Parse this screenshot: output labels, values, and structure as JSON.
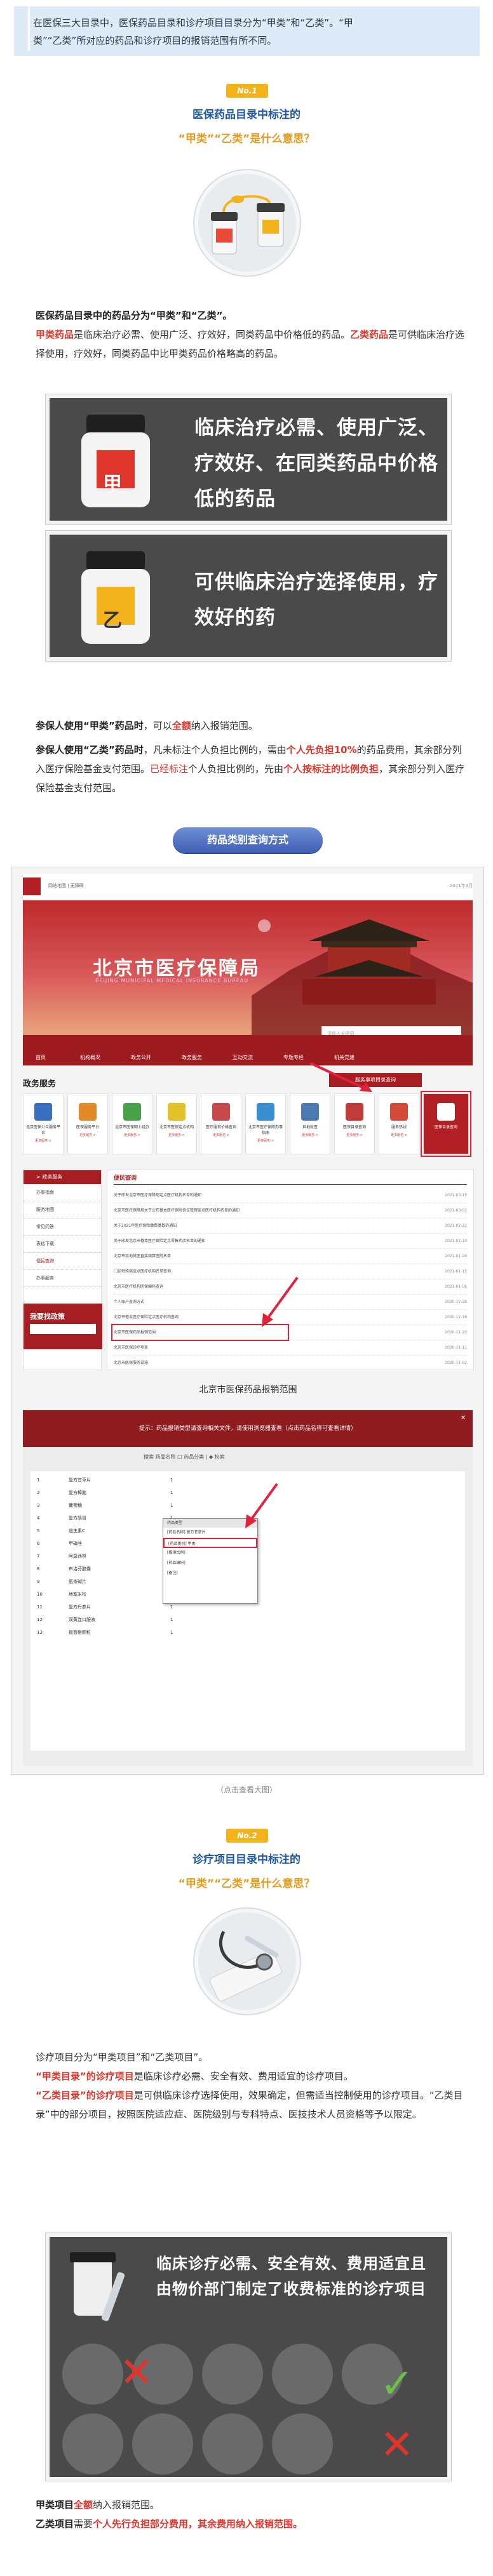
{
  "intro": {
    "line1": "在医保三大目录中，医保药品目录和诊疗项目目录分为“甲类”和“乙类”。“甲",
    "line2": "类”“乙类”所对应的药品和诊疗项目的报销范围有所不同。"
  },
  "section1": {
    "badge": "No.1",
    "title_blue": "医保药品目录",
    "title_rest": "中标注的",
    "subtitle": "“甲类”“乙类”是什么意思？",
    "para1_bold": "医保药品目录中的药品分为“甲类”和“乙类”。",
    "para2_red1": "甲类药品",
    "para2_text1": "是临床治疗必需、使用广泛、疗效好，同类药品中价格低的药品。",
    "para2_red2": "乙类药品",
    "para2_text2": "是可供临床治疗选择使用，疗效好，同类药品中比甲类药品价格略高的药品。",
    "card1_text": "临床治疗必需、使用广泛、疗效好、在同类药品中价格低的药品",
    "card1_label": "甲",
    "card2_text": "可供临床治疗选择使用，疗效好的药",
    "card2_label": "乙",
    "use1_bold": "参保人使用“甲类”药品时",
    "use1_text1": "，可以",
    "use1_red": "全额",
    "use1_text2": "纳入报销范围。",
    "use2_bold": "参保人使用“乙类”药品时",
    "use2_text1": "，凡未标注个人负担比例的，需由",
    "use2_red1": "个人先负担10%",
    "use2_text2": "的药品费用，其余部分列入医疗保险基金支付范围。",
    "use2_redplain": "已经标注",
    "use2_text3": "个人负担比例的，先由",
    "use2_red2": "个人按标注的比例负担",
    "use2_text4": "，其余部分列入医疗保险基金支付范围。",
    "button": "药品类别查询方式"
  },
  "screenshot": {
    "banner_title": "北京市医疗保障局",
    "banner_sub": "BEIJING MUNICIPAL MEDICAL INSURANCE BUREAU",
    "head_links": "网站地图  |  无障碍",
    "head_right": "2021年3月",
    "nav_items": [
      "首页",
      "机构概况",
      "政务公开",
      "政务服务",
      "互动交流",
      "专题专栏",
      "机关党建"
    ],
    "search_placeholder": "请输入关键词",
    "gov_heading": "政务服务",
    "gov_button": "服务事项目录查询",
    "tiles": [
      {
        "label": "北京医保公众服务平台",
        "color": "#3a6fc0"
      },
      {
        "label": "医保服务平台",
        "color": "#e08a2a"
      },
      {
        "label": "北京市医保网上经办",
        "color": "#49a24a"
      },
      {
        "label": "北京市医保定点机构",
        "color": "#e2c12a"
      },
      {
        "label": "医疗服务价格查询",
        "color": "#c94a4a"
      },
      {
        "label": "北京市医疗保障办事指南",
        "color": "#3a8fd0"
      },
      {
        "label": "异地就医",
        "color": "#4d7ab0"
      },
      {
        "label": "医保目录查询",
        "color": "#c23b3b"
      },
      {
        "label": "服务热线",
        "color": "#d34a3a"
      },
      {
        "label": "医保目录查询",
        "color": "#b21f24"
      }
    ],
    "tile_more": "更多服务 >",
    "left_menu_heading": "> 政务服务",
    "left_menu": [
      "办事指南",
      "服务地图",
      "常见问答",
      "表格下载",
      "便民查询",
      "办事服务"
    ],
    "help_title": "我要找政策",
    "news_heading": "便民查询",
    "news": [
      {
        "t": "关于印发北京市医疗保障局定点医疗机构名单的通知",
        "d": "2021-03-15"
      },
      {
        "t": "北京市医疗保障局关于公布基本医疗保险协议管理定点医疗机构名单的通知",
        "d": "2021-03-02"
      },
      {
        "t": "关于2021年医疗保险缴费基数的通知",
        "d": "2021-02-22"
      },
      {
        "t": "关于印发北京市基本医疗保险定点零售药店名单的通知",
        "d": "2021-02-10"
      },
      {
        "t": "北京市异地就医直接结算医院名单",
        "d": "2021-01-28"
      },
      {
        "t": "门诊特殊病定点医疗机构名单查询",
        "d": "2021-01-15"
      },
      {
        "t": "北京市医疗机构医保编码查询",
        "d": "2021-01-06"
      },
      {
        "t": "个人账户查询方式",
        "d": "2020-12-28"
      },
      {
        "t": "北京市基本医疗保险定点医疗机构查询",
        "d": "2020-12-18"
      },
      {
        "t": "企业医保登记、企业缴费情况查询",
        "d": "2020-12-09"
      },
      {
        "t": "医保卡挂失补办查询",
        "d": "2020-11-30"
      },
      {
        "t": "北京市医保药品报销范围",
        "d": "2020-11-20"
      },
      {
        "t": "北京市医保诊疗项目",
        "d": "2020-11-11"
      },
      {
        "t": "北京市医保服务设施",
        "d": "2020-11-02"
      },
      {
        "t": "门诊慢特病查询",
        "d": "2020-10-24"
      }
    ],
    "caption": "北京市医保药品报销范围",
    "sub_bar": "提示：药品报销类型请查询相关文件，请使用浏览器查看（点击药品名称可查看详情）",
    "sub_toolbar": "搜索 药品名称 □ 药品分类  |  ◆ 检索",
    "sub_rows": [
      {
        "n": "1",
        "name": "复方甘草片",
        "c": "1"
      },
      {
        "n": "2",
        "name": "复方樟脑",
        "c": "1"
      },
      {
        "n": "3",
        "name": "葡萄糖",
        "c": "1"
      },
      {
        "n": "4",
        "name": "复方感冒",
        "c": "1"
      },
      {
        "n": "5",
        "name": "维生素C",
        "c": "1"
      },
      {
        "n": "6",
        "name": "甲硝唑",
        "c": "1"
      },
      {
        "n": "7",
        "name": "阿莫西林",
        "c": "1"
      },
      {
        "n": "8",
        "name": "布洛芬胶囊",
        "c": "1"
      },
      {
        "n": "9",
        "name": "氨茶碱片",
        "c": "1"
      },
      {
        "n": "10",
        "name": "地塞米松",
        "c": "1"
      },
      {
        "n": "11",
        "name": "复方丹参片",
        "c": "1"
      },
      {
        "n": "12",
        "name": "双黄连口服液",
        "c": "1"
      },
      {
        "n": "13",
        "name": "板蓝根颗粒",
        "c": "1"
      }
    ],
    "popup_title": "药品类型",
    "popup_items": [
      "[药品名称]  复方甘草片",
      "[药品类别]  甲类",
      "[报销比例]",
      "[药品编码]",
      "[备注]"
    ]
  },
  "caption_below": "（点击查看大图）",
  "section2": {
    "badge": "No.2",
    "title_blue": "诊疗项目目录",
    "title_rest": "中标注的",
    "subtitle": "“甲类”“乙类”是什么意思？",
    "para1": "诊疗项目分为“甲类项目”和“乙类项目”。",
    "p2_red": "“甲类目录”的诊疗项目",
    "p2_text": "是临床诊疗必需、安全有效、费用适宜的诊疗项目。",
    "p3_red": "“乙类目录”的诊疗项目",
    "p3_text": "是可供临床诊疗选择使用，效果确定，但需适当控制使用的诊疗项目。“乙类目录”中的部分项目，按照医院适应症、医院级别与专科特点、医技技术人员资格等予以限定。",
    "card_text": "临床诊疗必需、安全有效、费用适宜且由物价部门制定了收费标准的诊疗项目",
    "tail1_bold": "甲类项目",
    "tail1_red": "全额",
    "tail1_text": "纳入报销范围。",
    "tail2_bold": "乙类项目",
    "tail2_text1": "需要",
    "tail2_red": "个人先行负担部分费用，其余费用纳入报销范围。"
  }
}
